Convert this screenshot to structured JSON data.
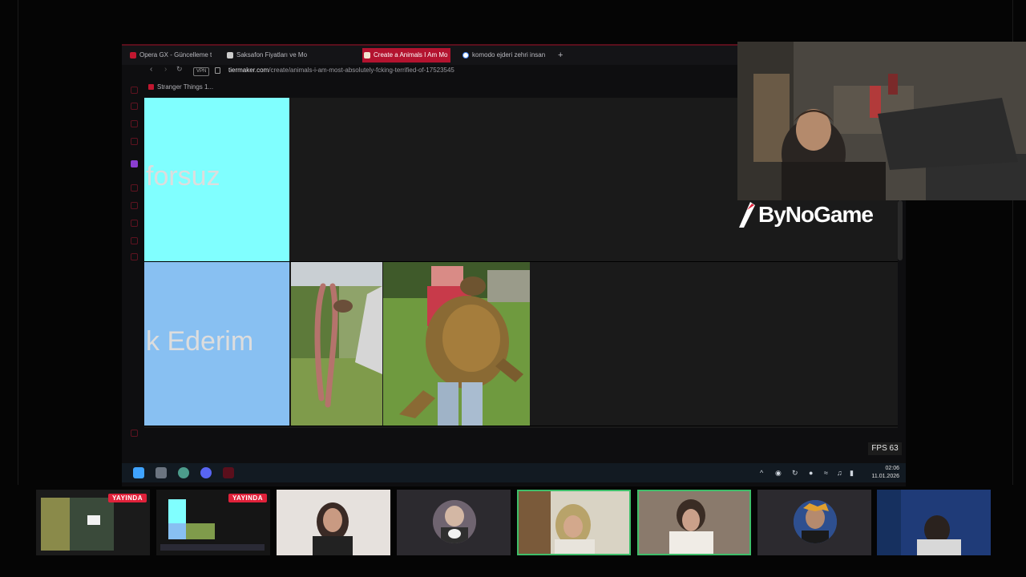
{
  "browser": {
    "tabs": [
      {
        "label": "Opera GX - Güncelleme te",
        "active": false
      },
      {
        "label": "Saksafon Fiyatları ve Mo",
        "active": false
      },
      {
        "label": "Create a Animals I Am Mo",
        "active": true
      },
      {
        "label": "komodo ejderi zehri insan",
        "active": false
      }
    ],
    "new_tab": "+",
    "vpn": "VPN",
    "url_host": "tiermaker.com",
    "url_path": "/create/animals-i-am-most-absolutely-fcking-terrified-of-17523545",
    "bookmark": "Stranger Things 1..."
  },
  "tierlist": {
    "rows": [
      {
        "label": "forsuz",
        "color": "#80ffff"
      },
      {
        "label": "k Ederim",
        "color": "#88c0f2"
      }
    ]
  },
  "overlay": {
    "logo": "ByNoGame",
    "fps": "FPS 63"
  },
  "taskbar": {
    "time": "02:06",
    "date": "11.01.2026"
  },
  "participants": {
    "live_label": "YAYINDA",
    "tiles": [
      {
        "type": "screen",
        "live": true
      },
      {
        "type": "screen",
        "live": true
      },
      {
        "type": "camera",
        "live": false
      },
      {
        "type": "avatar",
        "live": false
      },
      {
        "type": "camera",
        "live": false,
        "speaking": true
      },
      {
        "type": "camera",
        "live": false,
        "speaking": true
      },
      {
        "type": "avatar",
        "live": false
      },
      {
        "type": "camera",
        "live": false
      }
    ]
  }
}
